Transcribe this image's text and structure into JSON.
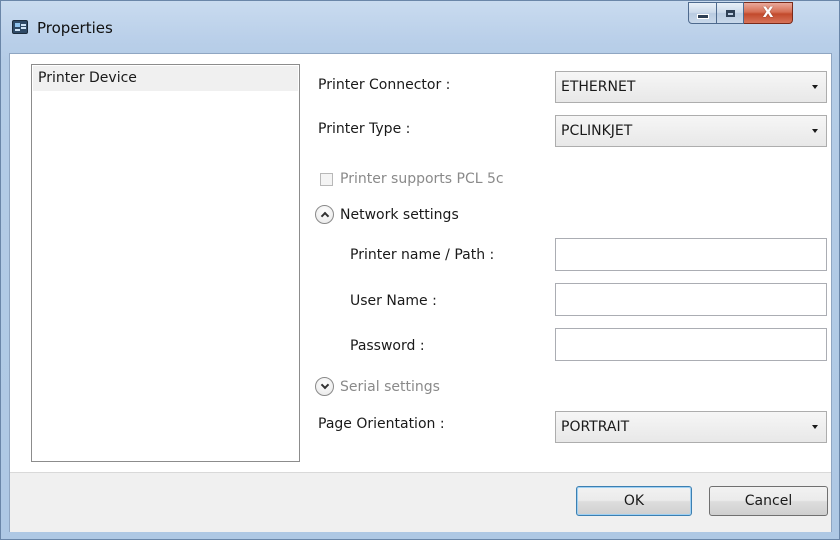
{
  "window": {
    "title": "Properties",
    "close_label": "X"
  },
  "tree": {
    "items": [
      {
        "label": "Printer Device",
        "selected": true
      }
    ]
  },
  "form": {
    "printer_connector": {
      "label": "Printer Connector  :",
      "value": "ETHERNET"
    },
    "printer_type": {
      "label": "Printer Type :",
      "value": "PCLINKJET"
    },
    "pcl5c": {
      "label": "Printer supports PCL 5c",
      "checked": false,
      "enabled": false
    },
    "network_settings": {
      "label": "Network settings",
      "expanded": true,
      "printer_name_label": "Printer name / Path  :",
      "printer_name_value": "",
      "user_name_label": "User Name  :",
      "user_name_value": "",
      "password_label": "Password  :",
      "password_value": ""
    },
    "serial_settings": {
      "label": "Serial settings",
      "expanded": false,
      "enabled": false
    },
    "page_orientation": {
      "label": "Page Orientation :",
      "value": "PORTRAIT"
    }
  },
  "buttons": {
    "ok": "OK",
    "cancel": "Cancel"
  },
  "colors": {
    "titlebar": "#b9cfe9",
    "close_button": "#c24a2c",
    "footer": "#f0f0f0",
    "selection": "#f0f0f0"
  }
}
